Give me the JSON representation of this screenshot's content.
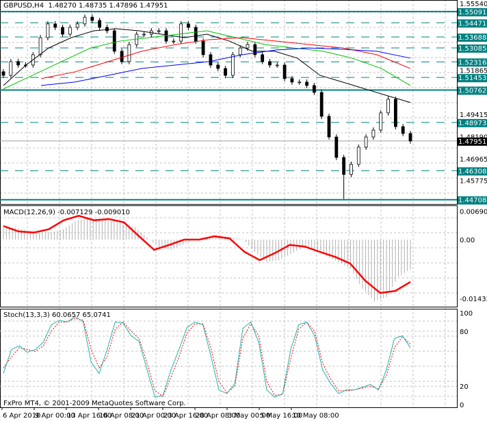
{
  "header": {
    "symbol": "GBPUSD,H4",
    "open": "1.48270",
    "high": "1.48735",
    "low": "1.47896",
    "close": "1.47951"
  },
  "macd_label": "MACD(12,26,9) -0.007129 -0.009010",
  "stoch_label": "Stoch(13,3,3) 60.0657 65.0741",
  "copyright": "FxPro MT4, © 2001-2009 MetaQuotes Software Corp.",
  "colors": {
    "level": "#008080",
    "macd": "#ff0000",
    "stoch_main": "#20b2aa",
    "stoch_signal": "#ff0000",
    "ma_black": "#000000",
    "ma_green": "#00c000",
    "ma_red": "#ff0000",
    "ma_blue": "#0000ff",
    "bull": "#000000",
    "bear": "#000000"
  },
  "chart_data": [
    {
      "type": "candlestick",
      "title": "GBPUSD,H4",
      "ylim": [
        1.447,
        1.5554
      ],
      "y_ticks": [
        "1.55540",
        "1.51865",
        "1.49415",
        "1.48190",
        "1.46965",
        "1.45775"
      ],
      "levels_solid": [
        "1.55091",
        "1.50762",
        "1.44708"
      ],
      "levels_dashed": [
        "1.54471",
        "1.53688",
        "1.53085",
        "1.52316",
        "1.51453",
        "1.48973",
        "1.46308"
      ],
      "current_price": "1.47951",
      "closes": [
        1.5157,
        1.5233,
        1.5214,
        1.5214,
        1.5271,
        1.5365,
        1.5441,
        1.5422,
        1.5384,
        1.5422,
        1.5441,
        1.5478,
        1.546,
        1.5422,
        1.5403,
        1.529,
        1.5233,
        1.5327,
        1.5384,
        1.5384,
        1.5403,
        1.5403,
        1.5346,
        1.5346,
        1.5441,
        1.5422,
        1.5346,
        1.5271,
        1.5214,
        1.5195,
        1.5157,
        1.5271,
        1.5308,
        1.5327,
        1.5271,
        1.5233,
        1.5214,
        1.5214,
        1.5139,
        1.512,
        1.512,
        1.5101,
        1.5063,
        1.4931,
        1.4817,
        1.4704,
        1.461,
        1.4666,
        1.4761,
        1.4817,
        1.4855,
        1.495,
        1.5025,
        1.4874,
        1.4836,
        1.4795
      ],
      "ma": [
        {
          "name": "black",
          "values": [
            1.5101,
            1.5214,
            1.5308,
            1.5365,
            1.5403,
            1.5414,
            1.5403,
            1.5384,
            1.5365,
            1.5384,
            1.5346,
            1.529,
            1.529,
            1.5252,
            1.5157,
            1.512,
            1.5082,
            1.5044,
            1.5007
          ]
        },
        {
          "name": "green",
          "values": [
            1.5082,
            1.5157,
            1.5233,
            1.5308,
            1.5346,
            1.5365,
            1.5384,
            1.5403,
            1.5365,
            1.5327,
            1.5308,
            1.529,
            1.5252,
            1.5195,
            1.5101
          ]
        },
        {
          "name": "red",
          "values": [
            1.5139,
            1.5176,
            1.5233,
            1.529,
            1.5327,
            1.5354,
            1.5365,
            1.5346,
            1.5327,
            1.5308,
            1.5271,
            1.5195
          ]
        },
        {
          "name": "blue",
          "values": [
            1.5101,
            1.512,
            1.5157,
            1.5195,
            1.5214,
            1.5233,
            1.5271,
            1.5297,
            1.5308,
            1.5301,
            1.529,
            1.5252
          ]
        }
      ]
    },
    {
      "type": "macd",
      "title": "MACD(12,26,9)",
      "ylim": [
        -0.01432,
        0.0069
      ],
      "y_ticks": [
        "0.00690",
        "0.00",
        "-0.01432"
      ],
      "signal": [
        0.0033,
        0.002,
        0.0017,
        0.0025,
        0.0047,
        0.0058,
        0.0047,
        0.005,
        0.0042,
        0.0008,
        -0.0025,
        -0.0013,
        0.0,
        0.0,
        0.0008,
        0.0003,
        -0.003,
        -0.005,
        -0.0033,
        -0.0013,
        -0.0017,
        -0.003,
        -0.0042,
        -0.0058,
        -0.01,
        -0.013,
        -0.0125,
        -0.0103
      ],
      "histogram": [
        0.003,
        0.0028,
        0.0022,
        0.002,
        0.0018,
        0.0025,
        0.0045,
        0.0055,
        0.005,
        0.0045,
        0.004,
        0.003,
        0.0005,
        -0.002,
        -0.0025,
        -0.0012,
        0.0002,
        0.0004,
        0.0008,
        0.0006,
        0.0001,
        -0.003,
        -0.0055,
        -0.005,
        -0.0035,
        -0.002,
        -0.0025,
        -0.004,
        -0.0055,
        -0.007,
        -0.012,
        -0.015,
        -0.014,
        -0.009,
        -0.0072
      ]
    },
    {
      "type": "stochastic",
      "title": "Stoch(13,3,3)",
      "ylim": [
        0,
        100
      ],
      "y_ticks": [
        "100",
        "80",
        "20",
        "0"
      ],
      "main": [
        34,
        60,
        64,
        57,
        60,
        68,
        87,
        92,
        90,
        96,
        90,
        46,
        34,
        60,
        90,
        89,
        75,
        69,
        38,
        8,
        10,
        38,
        60,
        84,
        90,
        87,
        53,
        16,
        12,
        23,
        83,
        90,
        68,
        16,
        8,
        12,
        60,
        87,
        90,
        75,
        38,
        23,
        12,
        16,
        16,
        19,
        22,
        16,
        38,
        72,
        75,
        62
      ],
      "signal": [
        40,
        52,
        62,
        60,
        58,
        64,
        80,
        90,
        90,
        94,
        92,
        60,
        40,
        52,
        82,
        90,
        80,
        72,
        45,
        15,
        9,
        30,
        52,
        78,
        88,
        88,
        62,
        25,
        13,
        20,
        72,
        88,
        75,
        25,
        10,
        11,
        50,
        82,
        90,
        80,
        45,
        28,
        15,
        15,
        16,
        18,
        20,
        17,
        32,
        62,
        74,
        66
      ]
    },
    {
      "type": "x_axis",
      "labels": [
        "6 Apr 2010",
        "9 Apr 00:00",
        "13 Apr 16:00",
        "16 Apr 08:00",
        "21 Apr 00:00",
        "23 Apr 16:00",
        "28 Apr 08:00",
        "3 May 00:00",
        "5 May 16:00",
        "10 May 08:00"
      ]
    }
  ]
}
